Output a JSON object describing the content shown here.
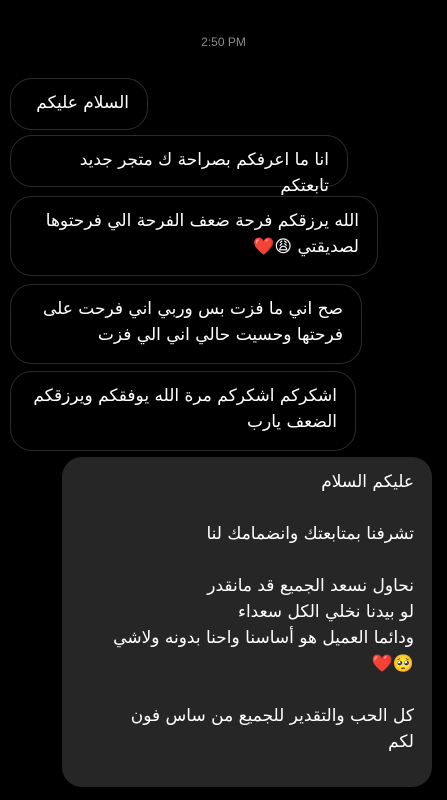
{
  "conversation": {
    "timestamp": "2:50 PM",
    "messages": [
      {
        "direction": "incoming",
        "text": "السلام عليكم"
      },
      {
        "direction": "incoming",
        "text": "انا ما اعرفكم بصراحة ك متجر جديد تابعتكم"
      },
      {
        "direction": "incoming",
        "text": "الله يرزقكم فرحة ضعف الفرحة الي فرحتوها\nلصديقتي 😩❤️"
      },
      {
        "direction": "incoming",
        "text": "صح اني ما فزت بس وربي اني فرحت على\nفرحتها وحسيت حالي اني الي فزت"
      },
      {
        "direction": "incoming",
        "text": "اشكركم اشكركم مرة الله يوفقكم ويرزقكم\nالضعف يارب"
      },
      {
        "direction": "outgoing",
        "text": "عليكم السلام\n\nتشرفنا بمتابعتك وانضمامك لنا\n\nنحاول نسعد الجميع قد مانقدر\nلو بيدنا نخلي الكل سعداء\nودائما العميل هو أساسنا واحنا بدونه ولاشي\n❤️🥺\n\nكل الحب والتقدير للجميع من ساس فون\nلكم"
      }
    ]
  },
  "colors": {
    "background": "#000000",
    "incoming_border": "#2b2b2b",
    "outgoing_fill": "#262626",
    "timestamp_text": "#8e8e8e",
    "message_text": "#ffffff"
  }
}
